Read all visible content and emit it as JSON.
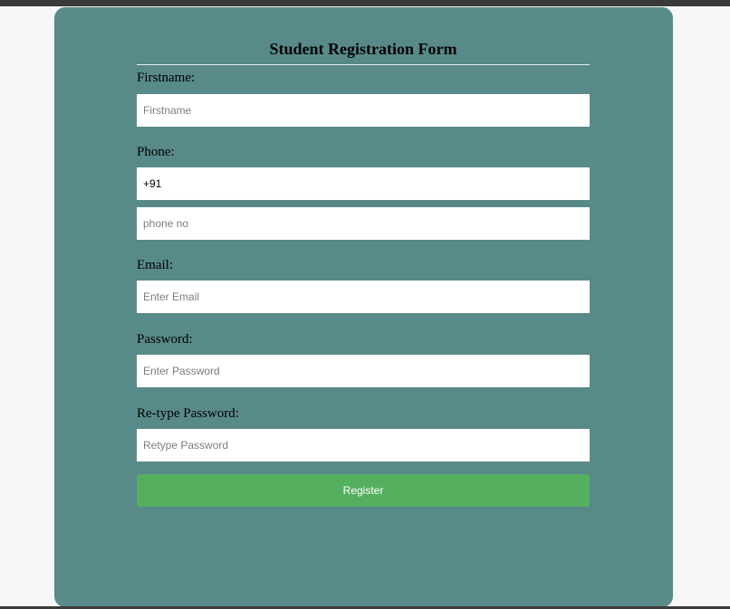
{
  "form": {
    "title": "Student Registration Form",
    "firstname": {
      "label": "Firstname:",
      "placeholder": "Firstname"
    },
    "phone": {
      "label": "Phone:",
      "country_code": "+91",
      "placeholder": "phone no"
    },
    "email": {
      "label": "Email:",
      "placeholder": "Enter Email"
    },
    "password": {
      "label": "Password:",
      "placeholder": "Enter Password"
    },
    "retype_password": {
      "label": "Re-type Password:",
      "placeholder": "Retype Password"
    },
    "register_label": "Register"
  },
  "colors": {
    "card_background": "#588a89",
    "register_button": "#54b05f",
    "page_background": "#f7f7f7"
  }
}
